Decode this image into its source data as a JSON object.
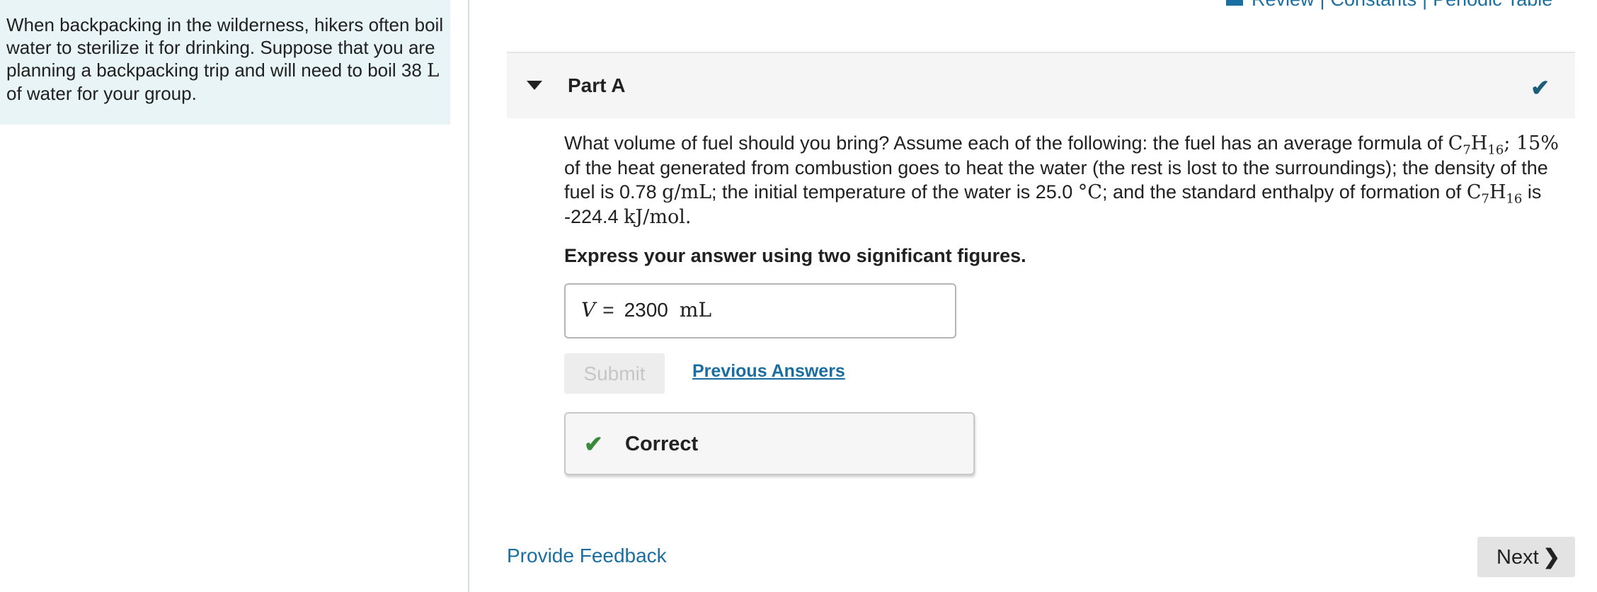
{
  "intro": {
    "text_before": "When backpacking in the wilderness, hikers often boil water to sterilize it for drinking. Suppose that you are planning a backpacking trip and will need to boil 38 ",
    "unit": "L",
    "text_after": " of water for your group."
  },
  "resources": {
    "review": "Review",
    "constants": "Constants",
    "periodic_table": "Periodic Table",
    "separator": "|"
  },
  "part": {
    "title": "Part A",
    "status_icon": "check-icon"
  },
  "question": {
    "s1": "What volume of fuel should you bring? Assume each of the following: the fuel has an average formula of ",
    "formula_c": "C",
    "formula_c_sub": "7",
    "formula_h": "H",
    "formula_h_sub": "16",
    "s2": "; 15",
    "percent": "%",
    "s3": " of the heat generated from combustion goes to heat the water (the rest is lost to the surroundings); the density of the fuel is 0.78 ",
    "density_unit": "g/mL",
    "s4": "; the initial temperature of the water is 25.0 ",
    "temp_unit": "°C",
    "s5": "; and the standard enthalpy of formation of ",
    "s6": " is -224.4 ",
    "enthalpy_unit": "kJ/mol",
    "s7": "."
  },
  "instruction": "Express your answer using two significant figures.",
  "answer": {
    "variable": "V",
    "equals": "=",
    "value": "2300",
    "unit": "mL"
  },
  "buttons": {
    "submit": "Submit",
    "previous_answers": "Previous Answers",
    "next": "Next",
    "next_icon": "chevron-right-icon"
  },
  "feedback": {
    "result": "Correct",
    "result_icon": "check-icon"
  },
  "footer": {
    "provide_feedback": "Provide Feedback"
  },
  "colors": {
    "intro_bg": "#e8f4f5",
    "link": "#1a6fa0",
    "part_check": "#1b5e7a",
    "correct_check": "#3a8a3e"
  }
}
